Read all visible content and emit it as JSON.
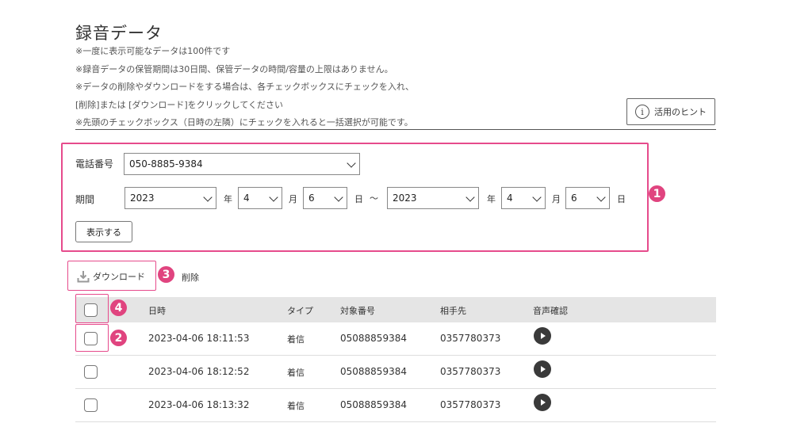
{
  "title": "録音データ",
  "notes": [
    "※一度に表示可能なデータは100件です",
    "※録音データの保管期間は30日間、保管データの時間/容量の上限はありません。",
    "※データの削除やダウンロードをする場合は、各チェックボックスにチェックを入れ、",
    "[削除]または [ダウンロード]をクリックしてください",
    "※先頭のチェックボックス（日時の左隣）にチェックを入れると一括選択が可能です。"
  ],
  "hint_button": {
    "label": "活用のヒント",
    "icon": "i"
  },
  "filter": {
    "phone_label": "電話番号",
    "phone_value": "050-8885-9384",
    "period_label": "期間",
    "from": {
      "year": "2023",
      "month": "4",
      "day": "6"
    },
    "to": {
      "year": "2023",
      "month": "4",
      "day": "6"
    },
    "year_unit": "年",
    "month_unit": "月",
    "day_unit": "日",
    "range_sep": "～",
    "show_button": "表示する"
  },
  "actions": {
    "download": "ダウンロード",
    "delete": "削除"
  },
  "badges": [
    "1",
    "2",
    "3",
    "4"
  ],
  "table": {
    "headers": [
      "日時",
      "タイプ",
      "対象番号",
      "相手先",
      "音声確認"
    ],
    "rows": [
      {
        "datetime": "2023-04-06 18:11:53",
        "type": "着信",
        "target": "05088859384",
        "partner": "0357780373"
      },
      {
        "datetime": "2023-04-06 18:12:52",
        "type": "着信",
        "target": "05088859384",
        "partner": "0357780373"
      },
      {
        "datetime": "2023-04-06 18:13:32",
        "type": "着信",
        "target": "05088859384",
        "partner": "0357780373"
      }
    ]
  },
  "colors": {
    "accent": "#e0447f",
    "header_bg": "#e5e5e5"
  }
}
